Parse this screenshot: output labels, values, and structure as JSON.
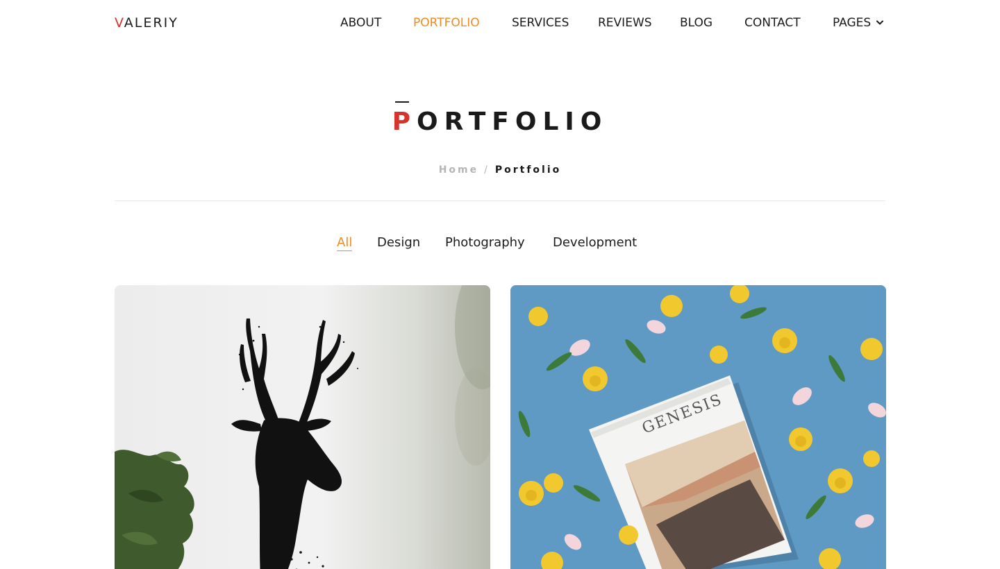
{
  "header": {
    "logo_first": "V",
    "logo_rest": "ALERIY",
    "nav": [
      {
        "label": "ABOUT",
        "active": false
      },
      {
        "label": "PORTFOLIO",
        "active": true
      },
      {
        "label": "SERVICES",
        "active": false
      },
      {
        "label": "REVIEWS",
        "active": false
      },
      {
        "label": "BLOG",
        "active": false
      },
      {
        "label": "CONTACT",
        "active": false
      },
      {
        "label": "PAGES",
        "active": false,
        "icon": "chevron-down-icon"
      }
    ]
  },
  "hero": {
    "title_first": "P",
    "title_rest": "ORTFOLIO",
    "breadcrumb": {
      "home": "Home",
      "separator": "/",
      "current": "Portfolio"
    }
  },
  "filters": [
    {
      "label": "All",
      "active": true
    },
    {
      "label": "Design",
      "active": false
    },
    {
      "label": "Photography",
      "active": false
    },
    {
      "label": "Development",
      "active": false
    }
  ],
  "portfolio": {
    "items": [
      {
        "image": "deer-silhouette-artwork"
      },
      {
        "image": "genesis-book-with-flowers",
        "book_title": "GENESIS"
      }
    ]
  },
  "colors": {
    "accent": "#f08a24",
    "brand_red": "#d8322c",
    "text": "#1a1a1a",
    "muted": "#b5b5b5"
  }
}
